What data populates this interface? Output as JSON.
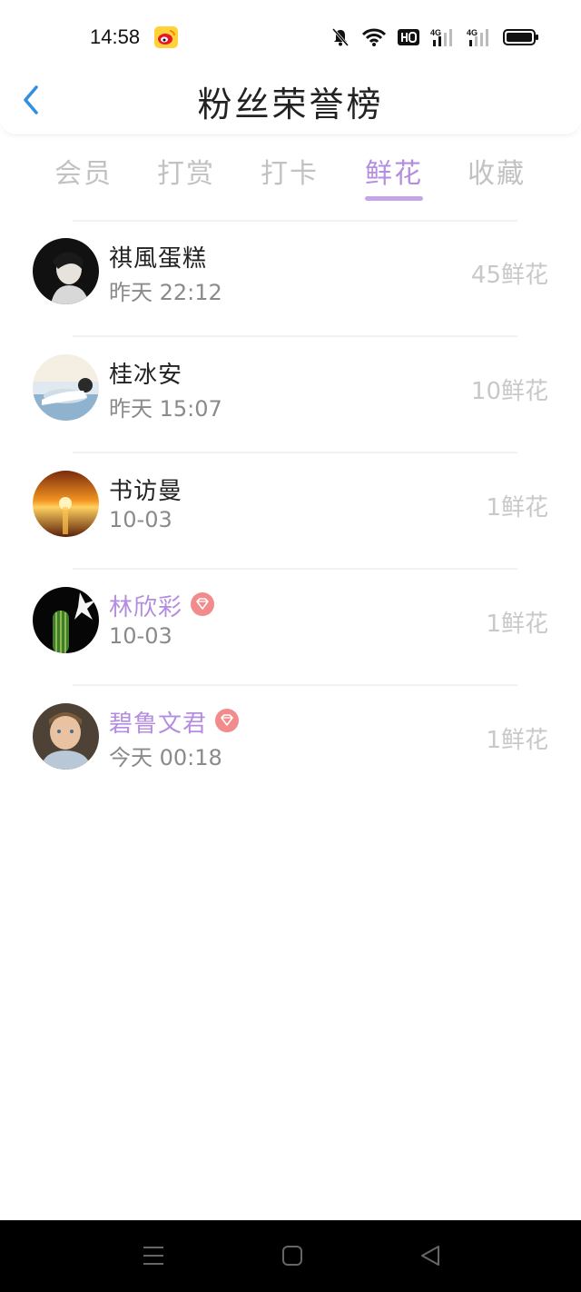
{
  "status": {
    "time": "14:58"
  },
  "header": {
    "title": "粉丝荣誉榜"
  },
  "tabs": [
    {
      "label": "会员"
    },
    {
      "label": "打赏"
    },
    {
      "label": "打卡"
    },
    {
      "label": "鲜花",
      "active": true
    },
    {
      "label": "收藏"
    }
  ],
  "fans": [
    {
      "name": "祺風蛋糕",
      "time": "昨天 22:12",
      "count": "45鲜花",
      "vip": false
    },
    {
      "name": "桂冰安",
      "time": "昨天 15:07",
      "count": "10鲜花",
      "vip": false
    },
    {
      "name": "书访曼",
      "time": "10-03",
      "count": "1鲜花",
      "vip": false
    },
    {
      "name": "林欣彩",
      "time": "10-03",
      "count": "1鲜花",
      "vip": true
    },
    {
      "name": "碧鲁文君",
      "time": "今天 00:18",
      "count": "1鲜花",
      "vip": true
    }
  ],
  "colors": {
    "accent": "#b48de0",
    "back_arrow": "#2f8fe0",
    "vip_badge": "#f28b8b"
  },
  "icons": {
    "back": "chevron-left-icon",
    "vip": "diamond-icon",
    "nav": [
      "menu-icon",
      "home-square-icon",
      "back-triangle-icon"
    ]
  }
}
